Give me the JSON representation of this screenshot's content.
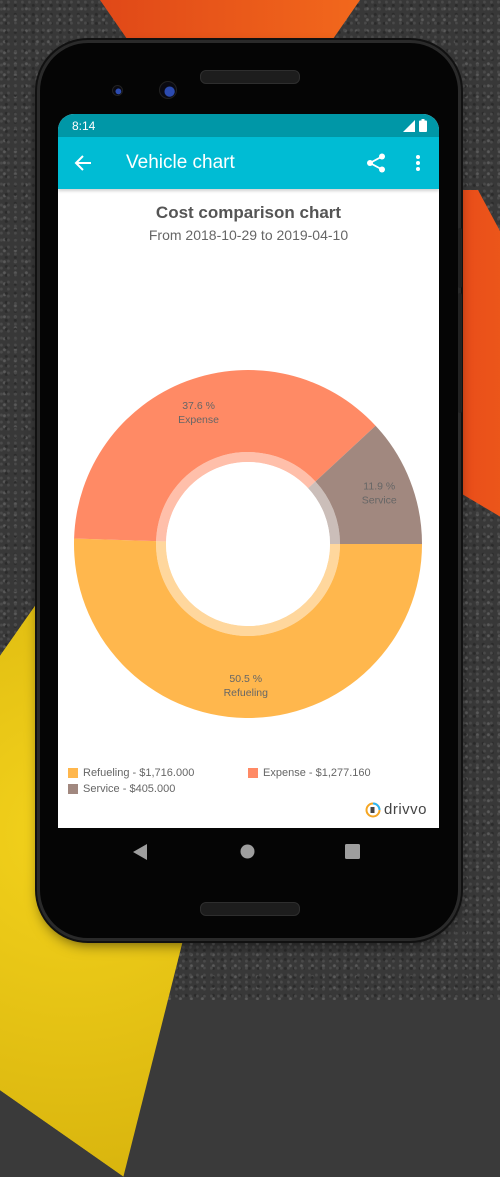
{
  "status_bar": {
    "time": "8:14",
    "icons": [
      "signal-icon",
      "battery-icon"
    ]
  },
  "app_bar": {
    "title": "Vehicle chart",
    "back_icon": "arrow-back-icon",
    "actions": [
      "share-icon",
      "more-vert-icon"
    ]
  },
  "colors": {
    "app_bar": "#00bcd4",
    "status_bar": "#0097a7",
    "refueling": "#ffb74d",
    "expense": "#ff8a65",
    "service": "#a1887f"
  },
  "chart_data": {
    "type": "pie",
    "variant": "donut",
    "title": "Cost comparison chart",
    "subtitle": "From 2018-10-29 to 2019-04-10",
    "start_angle_deg": 0,
    "direction": "clockwise",
    "slices": [
      {
        "name": "Refueling",
        "percent": 50.5,
        "percent_label": "50.5 %",
        "value": 1716.0,
        "legend": "Refueling - $1,716.000",
        "color": "#ffb74d"
      },
      {
        "name": "Expense",
        "percent": 37.6,
        "percent_label": "37.6 %",
        "value": 1277.16,
        "legend": "Expense - $1,277.160",
        "color": "#ff8a65"
      },
      {
        "name": "Service",
        "percent": 11.9,
        "percent_label": "11.9 %",
        "value": 405.0,
        "legend": "Service - $405.000",
        "color": "#a1887f"
      }
    ],
    "legend_position": "bottom-left"
  },
  "branding": {
    "name": "drivvo"
  },
  "nav_bar": {
    "buttons": [
      "back-nav-icon",
      "home-nav-icon",
      "recents-nav-icon"
    ]
  }
}
